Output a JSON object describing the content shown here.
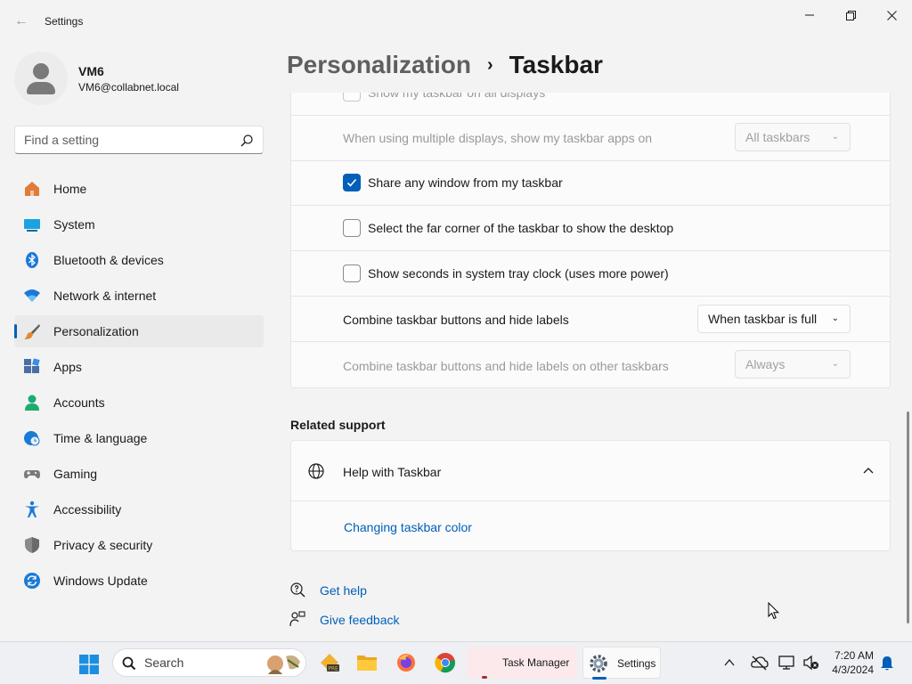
{
  "window": {
    "title": "Settings"
  },
  "user": {
    "name": "VM6",
    "email": "VM6@collabnet.local"
  },
  "search": {
    "placeholder": "Find a setting"
  },
  "sidebar": {
    "items": [
      {
        "label": "Home",
        "icon": "home-icon",
        "active": false
      },
      {
        "label": "System",
        "icon": "monitor-icon",
        "active": false
      },
      {
        "label": "Bluetooth & devices",
        "icon": "bluetooth-icon",
        "active": false
      },
      {
        "label": "Network & internet",
        "icon": "wifi-icon",
        "active": false
      },
      {
        "label": "Personalization",
        "icon": "brush-icon",
        "active": true
      },
      {
        "label": "Apps",
        "icon": "apps-icon",
        "active": false
      },
      {
        "label": "Accounts",
        "icon": "person-icon",
        "active": false
      },
      {
        "label": "Time & language",
        "icon": "clock-globe-icon",
        "active": false
      },
      {
        "label": "Gaming",
        "icon": "gamepad-icon",
        "active": false
      },
      {
        "label": "Accessibility",
        "icon": "accessibility-icon",
        "active": false
      },
      {
        "label": "Privacy & security",
        "icon": "shield-icon",
        "active": false
      },
      {
        "label": "Windows Update",
        "icon": "update-icon",
        "active": false
      }
    ]
  },
  "header": {
    "parent": "Personalization",
    "separator": "›",
    "current": "Taskbar"
  },
  "settings": {
    "show_all_displays": {
      "label": "Show my taskbar on all displays",
      "checked": false,
      "disabled": true
    },
    "multiple_displays": {
      "label": "When using multiple displays, show my taskbar apps on",
      "value": "All taskbars",
      "disabled": true
    },
    "share_window": {
      "label": "Share any window from my taskbar",
      "checked": true
    },
    "far_corner": {
      "label": "Select the far corner of the taskbar to show the desktop",
      "checked": false
    },
    "show_seconds": {
      "label": "Show seconds in system tray clock (uses more power)",
      "checked": false
    },
    "combine_buttons": {
      "label": "Combine taskbar buttons and hide labels",
      "value": "When taskbar is full"
    },
    "combine_other": {
      "label": "Combine taskbar buttons and hide labels on other taskbars",
      "value": "Always",
      "disabled": true
    }
  },
  "related_support": {
    "title": "Related support",
    "help": {
      "label": "Help with Taskbar",
      "expanded": true,
      "links": [
        "Changing taskbar color"
      ]
    }
  },
  "footer_links": {
    "get_help": "Get help",
    "give_feedback": "Give feedback"
  },
  "taskbar": {
    "search_label": "Search",
    "apps": [
      {
        "label": "Task Manager",
        "icon": "task-manager-icon",
        "highlighted": true
      },
      {
        "label": "Settings",
        "icon": "settings-gear-icon",
        "active": true
      }
    ],
    "clock": {
      "time": "7:20 AM",
      "date": "4/3/2024"
    }
  },
  "colors": {
    "accent": "#005fb8",
    "background": "#f3f3f3",
    "card": "#fbfbfb"
  }
}
